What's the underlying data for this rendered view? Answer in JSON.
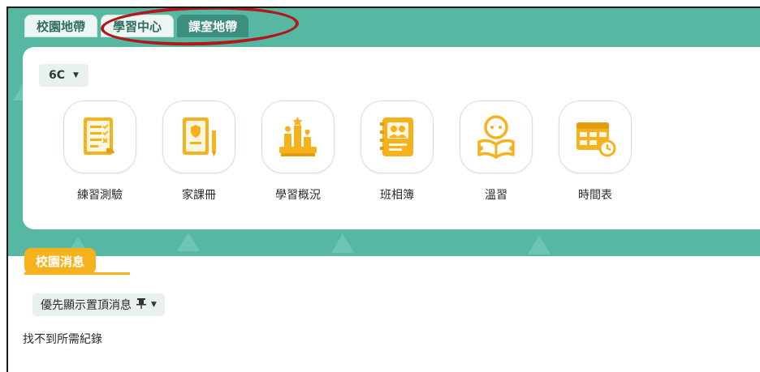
{
  "tabs": [
    {
      "label": "校園地帶"
    },
    {
      "label": "學習中心"
    },
    {
      "label": "課室地帶"
    }
  ],
  "class_select": {
    "value": "6C",
    "caret": "▼"
  },
  "apps": [
    {
      "label": "練習測驗",
      "icon": "quiz-checklist-icon"
    },
    {
      "label": "家課冊",
      "icon": "homework-book-icon"
    },
    {
      "label": "學習概況",
      "icon": "learning-overview-icon"
    },
    {
      "label": "班相簿",
      "icon": "class-album-icon"
    },
    {
      "label": "溫習",
      "icon": "revision-reader-icon"
    },
    {
      "label": "時間表",
      "icon": "timetable-icon"
    }
  ],
  "news": {
    "title": "校園消息",
    "filter_label": "優先顯示置頂消息",
    "pin_glyph": "窂",
    "caret": "▼",
    "empty_text": "找不到所需紀錄"
  },
  "colors": {
    "teal": "#56b7a3",
    "active_tab": "#3e8e7e",
    "accent_yellow": "#f6b21d",
    "annotation_red": "#b3171b"
  }
}
